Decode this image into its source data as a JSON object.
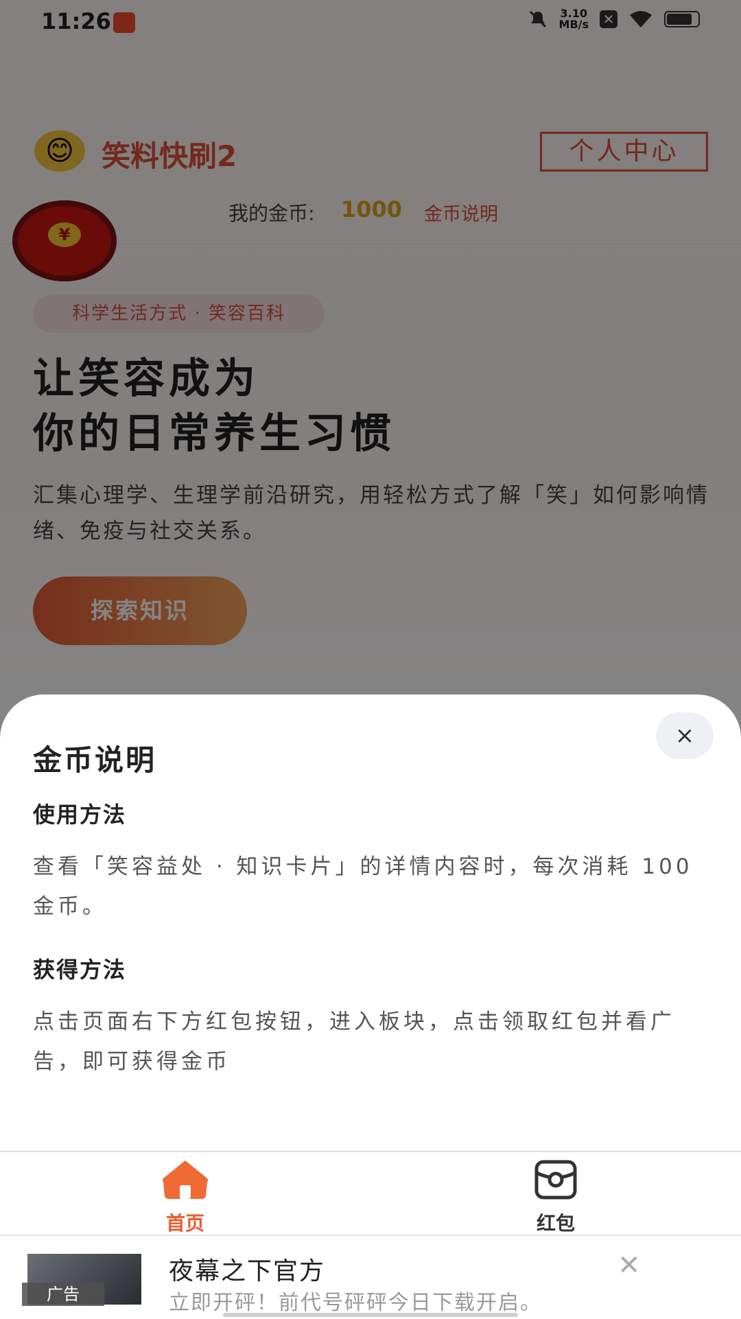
{
  "status_bar": {
    "time": "11:26",
    "speed_value": "3.10",
    "speed_unit": "MB/s"
  },
  "header": {
    "emoji": "😊",
    "app_title": "笑料快刷2",
    "profile_button": "个人中心",
    "coins_label": "我的金币:",
    "coins_value": "1000",
    "coins_help_link": "金币说明"
  },
  "floating_red_packet": {
    "symbol": "¥"
  },
  "hero": {
    "tagline": "科学生活方式 · 笑容百科",
    "title_line1": "让笑容成为",
    "title_line2": "你的日常养生习惯",
    "description": "汇集心理学、生理学前沿研究，用轻松方式了解「笑」如何影响情绪、免疫与社交关系。",
    "explore_button": "探索知识"
  },
  "coin_sheet": {
    "title": "金币说明",
    "close": "×",
    "usage_heading": "使用方法",
    "usage_text": "查看「笑容益处 · 知识卡片」的详情内容时，每次消耗 100 金币。",
    "earn_heading": "获得方法",
    "earn_text": "点击页面右下方红包按钮，进入板块，点击领取红包并看广告，即可获得金币"
  },
  "bottom_nav": {
    "items": [
      {
        "label": "首页",
        "icon": "home-icon",
        "active": true
      },
      {
        "label": "红包",
        "icon": "red-packet-icon",
        "active": false
      }
    ],
    "active_color": "#ee5a2e"
  },
  "ad_banner": {
    "tag": "广告",
    "title": "夜幕之下官方",
    "subtitle": "立即开砰！前代号砰砰今日下载开启。",
    "close": "✕"
  }
}
